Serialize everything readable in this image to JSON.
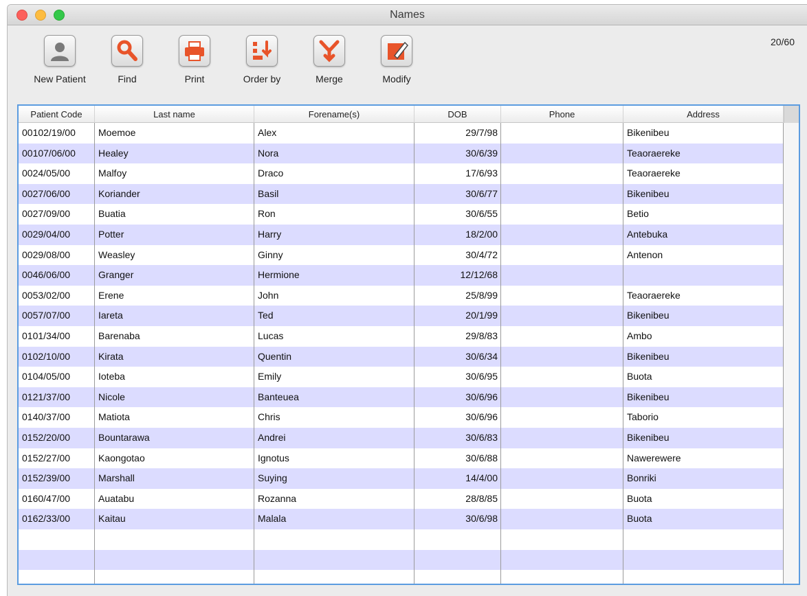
{
  "window": {
    "title": "Names"
  },
  "toolbar": {
    "buttons": [
      {
        "id": "new-patient",
        "label": "New Patient",
        "icon": "person-icon"
      },
      {
        "id": "find",
        "label": "Find",
        "icon": "magnifier-icon"
      },
      {
        "id": "print",
        "label": "Print",
        "icon": "printer-icon"
      },
      {
        "id": "order-by",
        "label": "Order by",
        "icon": "sort-icon"
      },
      {
        "id": "merge",
        "label": "Merge",
        "icon": "merge-icon"
      },
      {
        "id": "modify",
        "label": "Modify",
        "icon": "pencil-icon"
      }
    ]
  },
  "counter": "20/60",
  "colors": {
    "selection_border": "#5b9ce0",
    "row_alt": "#dcdcff",
    "accent_icon": "#e8542a"
  },
  "table": {
    "columns": [
      "Patient Code",
      "Last name",
      "Forename(s)",
      "DOB",
      "Phone",
      "Address"
    ],
    "rows": [
      [
        "00102/19/00",
        "Moemoe",
        "Alex",
        "29/7/98",
        "",
        "Bikenibeu"
      ],
      [
        "00107/06/00",
        "Healey",
        "Nora",
        "30/6/39",
        "",
        "Teaoraereke"
      ],
      [
        "0024/05/00",
        "Malfoy",
        "Draco",
        "17/6/93",
        "",
        "Teaoraereke"
      ],
      [
        "0027/06/00",
        "Koriander",
        "Basil",
        "30/6/77",
        "",
        "Bikenibeu"
      ],
      [
        "0027/09/00",
        "Buatia",
        "Ron",
        "30/6/55",
        "",
        "Betio"
      ],
      [
        "0029/04/00",
        "Potter",
        "Harry",
        "18/2/00",
        "",
        "Antebuka"
      ],
      [
        "0029/08/00",
        "Weasley",
        "Ginny",
        "30/4/72",
        "",
        "Antenon"
      ],
      [
        "0046/06/00",
        "Granger",
        "Hermione",
        "12/12/68",
        "",
        ""
      ],
      [
        "0053/02/00",
        "Erene",
        "John",
        "25/8/99",
        "",
        "Teaoraereke"
      ],
      [
        "0057/07/00",
        "Iareta",
        "Ted",
        "20/1/99",
        "",
        "Bikenibeu"
      ],
      [
        "0101/34/00",
        "Barenaba",
        "Lucas",
        "29/8/83",
        "",
        "Ambo"
      ],
      [
        "0102/10/00",
        "Kirata",
        "Quentin",
        "30/6/34",
        "",
        "Bikenibeu"
      ],
      [
        "0104/05/00",
        "Ioteba",
        "Emily",
        "30/6/95",
        "",
        "Buota"
      ],
      [
        "0121/37/00",
        "Nicole",
        "Banteuea",
        "30/6/96",
        "",
        "Bikenibeu"
      ],
      [
        "0140/37/00",
        "Matiota",
        "Chris",
        "30/6/96",
        "",
        "Taborio"
      ],
      [
        "0152/20/00",
        "Bountarawa",
        "Andrei",
        "30/6/83",
        "",
        "Bikenibeu"
      ],
      [
        "0152/27/00",
        "Kaongotao",
        "Ignotus",
        "30/6/88",
        "",
        "Nawerewere"
      ],
      [
        "0152/39/00",
        "Marshall",
        "Suying",
        "14/4/00",
        "",
        "Bonriki"
      ],
      [
        "0160/47/00",
        "Auatabu",
        "Rozanna",
        "28/8/85",
        "",
        "Buota"
      ],
      [
        "0162/33/00",
        "Kaitau",
        "Malala",
        "30/6/98",
        "",
        "Buota"
      ]
    ]
  }
}
